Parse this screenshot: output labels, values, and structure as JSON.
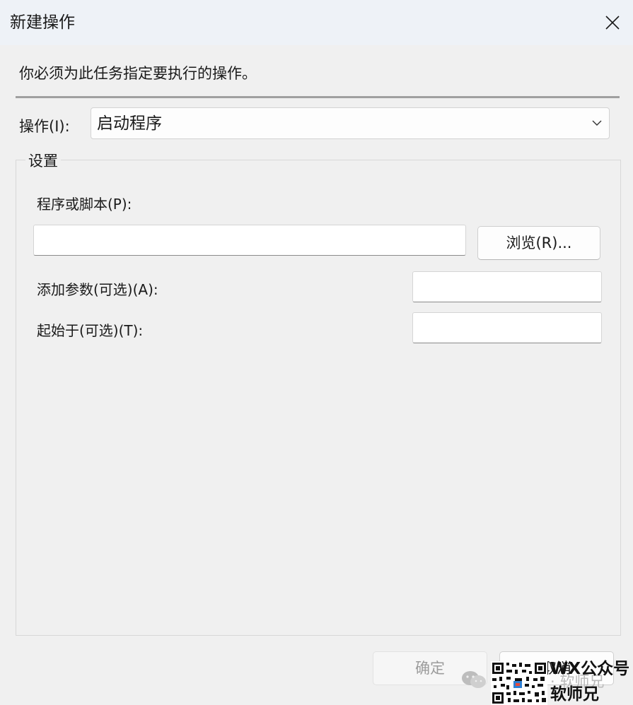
{
  "dialog": {
    "title": "新建操作",
    "instruction": "你必须为此任务指定要执行的操作。",
    "action": {
      "label": "操作(I):",
      "selected": "启动程序"
    },
    "settings": {
      "legend": "设置",
      "program_label": "程序或脚本(P):",
      "program_value": "",
      "browse_label": "浏览(R)...",
      "args_label": "添加参数(可选)(A):",
      "args_value": "",
      "start_label": "起始于(可选)(T):",
      "start_value": ""
    },
    "footer": {
      "ok_label": "确定",
      "cancel_label": "取消"
    }
  },
  "watermark": {
    "line1": "WX公众号",
    "line2": "软师兄",
    "faded": "· 软师兄"
  },
  "icons": {
    "close": "close-icon",
    "dropdown": "chevron-down-icon",
    "wechat": "wechat-icon",
    "qr": "qr-code"
  }
}
